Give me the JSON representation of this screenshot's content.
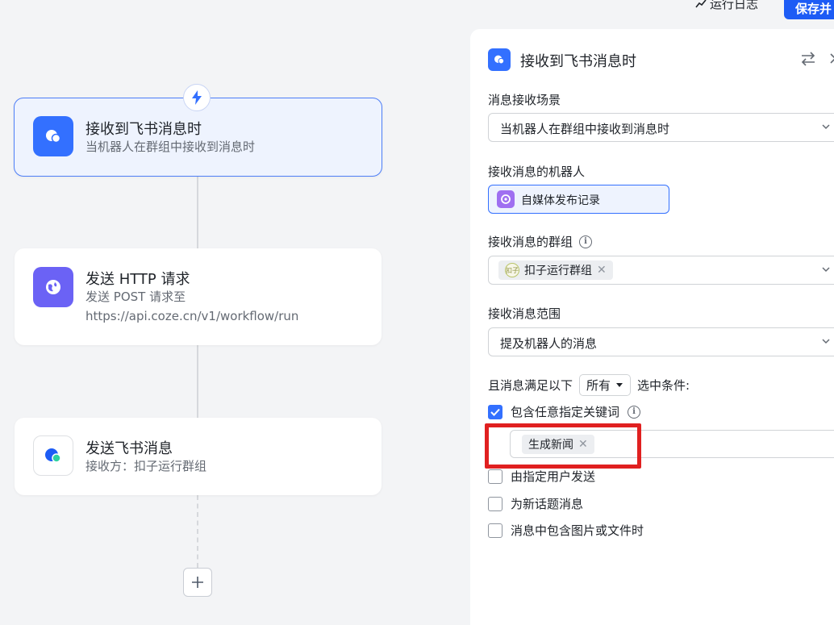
{
  "topbar": {
    "log_label": "运行日志",
    "save_label": "保存并"
  },
  "flow": {
    "nodes": [
      {
        "title": "接收到飞书消息时",
        "subtitle": "当机器人在群组中接收到消息时",
        "icon": "feishu-message-icon",
        "active": true
      },
      {
        "title": "发送 HTTP 请求",
        "subtitle_line1": "发送 POST 请求至",
        "subtitle_line2": "https://api.coze.cn/v1/workflow/run",
        "icon": "globe-icon"
      },
      {
        "title": "发送飞书消息",
        "subtitle": "接收方：扣子运行群组",
        "icon": "feishu-bubble-icon"
      }
    ],
    "trigger_icon": "lightning-icon",
    "add_icon": "plus-icon"
  },
  "panel": {
    "title": "接收到飞书消息时",
    "scene": {
      "label": "消息接收场景",
      "value": "当机器人在群组中接收到消息时"
    },
    "bot": {
      "label": "接收消息的机器人",
      "value": "自媒体发布记录"
    },
    "group": {
      "label": "接收消息的群组",
      "tag": "扣子运行群组",
      "avatar_text": "扣子"
    },
    "range": {
      "label": "接收消息范围",
      "value": "提及机器人的消息"
    },
    "condition": {
      "prefix": "且消息满足以下",
      "mode": "所有",
      "suffix": "选中条件:"
    },
    "checks": [
      {
        "label": "包含任意指定关键词",
        "checked": true
      },
      {
        "label": "由指定用户发送",
        "checked": false
      },
      {
        "label": "为新话题消息",
        "checked": false
      },
      {
        "label": "消息中包含图片或文件时",
        "checked": false
      }
    ],
    "keywords": [
      "生成新闻"
    ]
  },
  "colors": {
    "accent": "#3370ff",
    "highlight": "#e02020",
    "canvas_bg": "#f3f4f6"
  }
}
